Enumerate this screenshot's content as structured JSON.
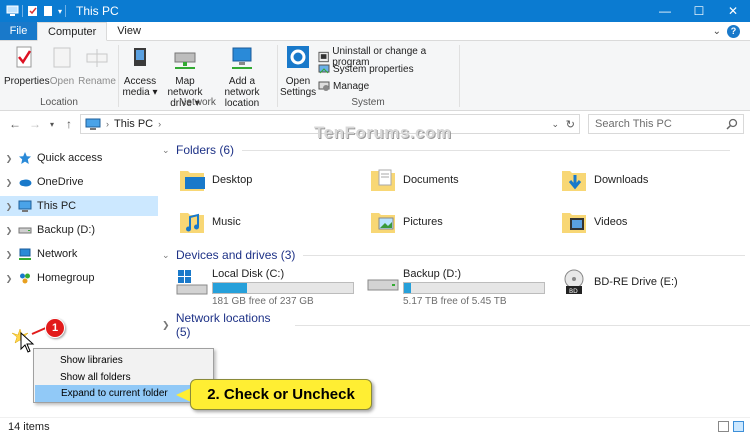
{
  "window": {
    "title": "This PC",
    "controls": [
      "minimize",
      "maximize",
      "close"
    ]
  },
  "ribbon": {
    "tabs": [
      {
        "label": "File"
      },
      {
        "label": "Computer"
      },
      {
        "label": "View"
      }
    ],
    "location": {
      "label": "Location",
      "buttons": [
        {
          "label": "Properties",
          "enabled": true
        },
        {
          "label": "Open",
          "enabled": false
        },
        {
          "label": "Rename",
          "enabled": false
        }
      ]
    },
    "network": {
      "label": "Network",
      "access_media": {
        "line1": "Access",
        "line2": "media ▾"
      },
      "map_drive": {
        "line1": "Map network",
        "line2": "drive ▾"
      },
      "add_location": {
        "line1": "Add a network",
        "line2": "location"
      }
    },
    "system": {
      "label": "System",
      "open_settings": {
        "line1": "Open",
        "line2": "Settings"
      },
      "uninstall": "Uninstall or change a program",
      "system_properties": "System properties",
      "manage": "Manage"
    }
  },
  "address": {
    "path": "This PC",
    "search_placeholder": "Search This PC"
  },
  "watermark": "TenForums.com",
  "nav": {
    "items": [
      {
        "label": "Quick access"
      },
      {
        "label": "OneDrive"
      },
      {
        "label": "This PC"
      },
      {
        "label": "Backup (D:)"
      },
      {
        "label": "Network"
      },
      {
        "label": "Homegroup"
      }
    ]
  },
  "content": {
    "folders_header": "Folders (6)",
    "folders": [
      {
        "label": "Desktop"
      },
      {
        "label": "Documents"
      },
      {
        "label": "Downloads"
      },
      {
        "label": "Music"
      },
      {
        "label": "Pictures"
      },
      {
        "label": "Videos"
      }
    ],
    "devices_header": "Devices and drives (3)",
    "drives": [
      {
        "label": "Local Disk (C:)",
        "free": "181 GB free of 237 GB",
        "used_fraction": 0.24
      },
      {
        "label": "Backup (D:)",
        "free": "5.17 TB free of 5.45 TB",
        "used_fraction": 0.05
      },
      {
        "label": "BD-RE Drive (E:)"
      }
    ],
    "network_header": "Network locations (5)"
  },
  "status": {
    "items": "14 items"
  },
  "context_menu": {
    "items": [
      {
        "label": "Show libraries"
      },
      {
        "label": "Show all folders"
      },
      {
        "label": "Expand to current folder"
      }
    ]
  },
  "callouts": {
    "step1": "1",
    "step2": "2. Check or Uncheck"
  },
  "colors": {
    "titlebar": "#0b7bd1",
    "selection": "#cce8ff",
    "drive_bar": "#26a0da",
    "callout": "#ffee33",
    "badge": "#e21b1b"
  }
}
